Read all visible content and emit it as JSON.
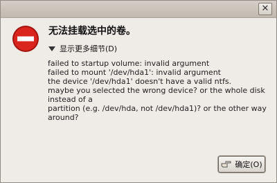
{
  "window": {
    "close_glyph": "✕"
  },
  "dialog": {
    "heading": "无法挂载选中的卷。",
    "details_label": "显示更多细节(D)",
    "message": "failed to startup volume: invalid argument\nfailed to mount '/dev/hda1': invalid argument\nthe device '/dev/hda1' doesn't have a valid ntfs.\nmaybe you selected the wrong device? or the whole disk instead of a\npartition (e.g. /dev/hda, not /dev/hda1)? or the other way around?",
    "ok_label": "确定(O)"
  },
  "icons": {
    "error": "stop-error-icon",
    "expander": "triangle-down-icon",
    "ok": "pointing-hand-icon"
  },
  "colors": {
    "error_red": "#d9251d",
    "titlebar": "#c9c3ba"
  }
}
